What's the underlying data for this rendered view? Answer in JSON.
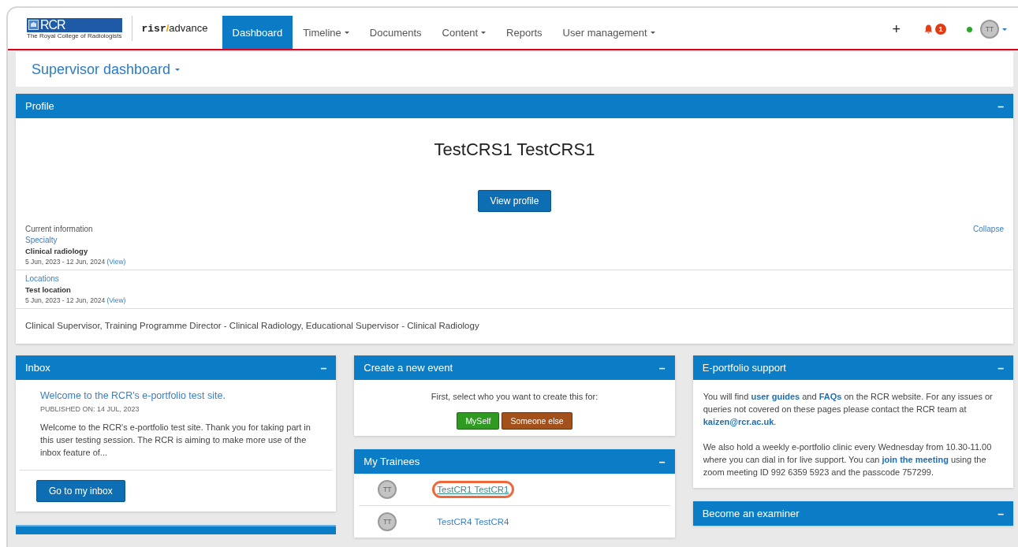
{
  "navbar": {
    "logo": {
      "text": "RCR",
      "caption": "The Royal College of Radiologists"
    },
    "brand_parts": [
      "risr",
      "/",
      "advance"
    ],
    "tabs": [
      {
        "label": "Dashboard",
        "selected": true,
        "dropdown": false
      },
      {
        "label": "Timeline",
        "selected": false,
        "dropdown": true
      },
      {
        "label": "Documents",
        "selected": false,
        "dropdown": false
      },
      {
        "label": "Content",
        "selected": false,
        "dropdown": true
      },
      {
        "label": "Reports",
        "selected": false,
        "dropdown": false
      },
      {
        "label": "User management",
        "selected": false,
        "dropdown": true
      }
    ],
    "add_label": "+",
    "notification_count": "1",
    "user": {
      "initials": "TT",
      "online": true
    }
  },
  "page_title": "Supervisor dashboard",
  "profile": {
    "title": "Profile",
    "collapse_symbol": "–",
    "name": "TestCRS1 TestCRS1",
    "button": "View profile",
    "current_label": "Current information",
    "collapse_link": "Collapse",
    "sections": [
      {
        "heading": "Specialty",
        "value": "Clinical radiology",
        "dates": "5 Jun, 2023 - 12 Jun, 2024",
        "view": "(View)"
      },
      {
        "heading": "Locations",
        "value": "Test location",
        "dates": "5 Jun, 2023 - 12 Jun, 2024",
        "view": "(View)"
      }
    ],
    "roles": "Clinical Supervisor, Training Programme Director - Clinical Radiology, Educational Supervisor - Clinical Radiology"
  },
  "inbox": {
    "title": "Inbox",
    "collapse_symbol": "–",
    "message_title": "Welcome to the RCR's e-portfolio test site.",
    "published": "PUBLISHED ON: 14 JUL, 2023",
    "excerpt": "Welcome to the RCR's e-portfolio test site. Thank you for taking part in this user testing session. The RCR is aiming to make more use of the inbox feature of...",
    "button": "Go to my inbox"
  },
  "create_event": {
    "title": "Create a new event",
    "collapse_symbol": "–",
    "prompt": "First, select who you want to create this for:",
    "options": [
      {
        "label": "MySelf",
        "color": "#2e9a22"
      },
      {
        "label": "Someone else",
        "color": "#a4501a"
      }
    ]
  },
  "trainees": {
    "title": "My Trainees",
    "collapse_symbol": "–",
    "items": [
      {
        "initials": "TT",
        "name": "TestCR1 TestCR1",
        "highlighted": true
      },
      {
        "initials": "TT",
        "name": "TestCR4 TestCR4",
        "highlighted": false
      }
    ]
  },
  "support": {
    "title": "E-portfolio support",
    "collapse_symbol": "–",
    "paragraphs": [
      [
        {
          "kind": "text",
          "text": "You will find "
        },
        {
          "kind": "link",
          "text": "user guides"
        },
        {
          "kind": "text",
          "text": " and "
        },
        {
          "kind": "link",
          "text": "FAQs"
        },
        {
          "kind": "text",
          "text": " on the RCR website. For any issues or queries not covered on these pages please contact the RCR team at "
        },
        {
          "kind": "link",
          "text": "kaizen@rcr.ac.uk"
        },
        {
          "kind": "text",
          "text": "."
        }
      ],
      [
        {
          "kind": "text",
          "text": "We also hold a weekly e-portfolio clinic every Wednesday from 10.30-11.00 where you can dial in for live support. You can "
        },
        {
          "kind": "link",
          "text": "join the meeting"
        },
        {
          "kind": "text",
          "text": " using the zoom meeting ID 992 6359 5923 and the passcode 757299."
        }
      ]
    ]
  },
  "examiner": {
    "title": "Become an examiner",
    "collapse_symbol": "–"
  }
}
